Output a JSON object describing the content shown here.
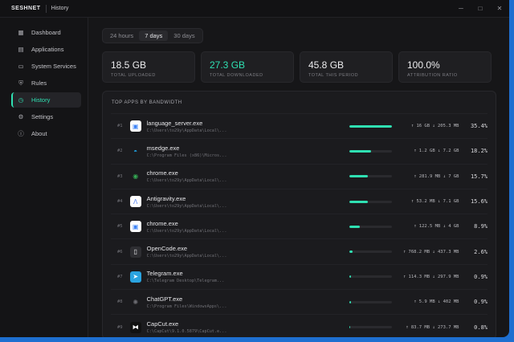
{
  "titlebar": {
    "brand": "SESHNET",
    "title": "History",
    "minimize": "─",
    "maximize": "□",
    "close": "✕"
  },
  "sidebar": {
    "items": [
      {
        "label": "Dashboard",
        "icon": "dashboard-icon",
        "glyph": "▦"
      },
      {
        "label": "Applications",
        "icon": "applications-icon",
        "glyph": "▤"
      },
      {
        "label": "System Services",
        "icon": "services-icon",
        "glyph": "▭"
      },
      {
        "label": "Rules",
        "icon": "shield-icon",
        "glyph": "⛨"
      },
      {
        "label": "History",
        "icon": "clock-icon",
        "glyph": "◷",
        "active": true
      },
      {
        "label": "Settings",
        "icon": "gear-icon",
        "glyph": "⚙"
      },
      {
        "label": "About",
        "icon": "info-icon",
        "glyph": "ⓘ"
      }
    ]
  },
  "tabs": [
    {
      "label": "24 hours"
    },
    {
      "label": "7 days",
      "active": true
    },
    {
      "label": "30 days"
    }
  ],
  "stats": [
    {
      "value": "18.5 GB",
      "label": "TOTAL UPLOADED"
    },
    {
      "value": "27.3 GB",
      "label": "TOTAL DOWNLOADED",
      "accent": true
    },
    {
      "value": "45.8 GB",
      "label": "TOTAL THIS PERIOD"
    },
    {
      "value": "100.0%",
      "label": "ATTRIBUTION RATIO"
    }
  ],
  "panel": {
    "title": "TOP APPS BY BANDWIDTH"
  },
  "colors": {
    "accent": "#2fe0b2",
    "background": "#161618",
    "card": "#1f1f22"
  },
  "apps": [
    {
      "rank": "#1",
      "name": "language_server.exe",
      "path": "C:\\Users\\to29y\\AppData\\Local\\...",
      "traffic": "↑ 16 GB  ↓ 205.3 MB",
      "pct": "35.4%",
      "share": 0.354,
      "icon": "vscode-icon",
      "glyph": "▣",
      "fg": "#3b82f6",
      "bg": "#ffffff"
    },
    {
      "rank": "#2",
      "name": "msedge.exe",
      "path": "C:\\Program Files (x86)\\Micros...",
      "traffic": "↑ 1.2 GB  ↓ 7.2 GB",
      "pct": "18.2%",
      "share": 0.182,
      "icon": "edge-icon",
      "glyph": "◓",
      "fg": "#1fa6e8",
      "bg": "transparent"
    },
    {
      "rank": "#3",
      "name": "chrome.exe",
      "path": "C:\\Users\\to29y\\AppData\\Local\\...",
      "traffic": "↑ 281.9 MB  ↓ 7 GB",
      "pct": "15.7%",
      "share": 0.157,
      "icon": "chrome-icon",
      "glyph": "◉",
      "fg": "#34a853",
      "bg": "transparent"
    },
    {
      "rank": "#4",
      "name": "Antigravity.exe",
      "path": "C:\\Users\\to29y\\AppData\\Local\\...",
      "traffic": "↑ 53.2 MB  ↓ 7.1 GB",
      "pct": "15.6%",
      "share": 0.156,
      "icon": "antigravity-icon",
      "glyph": "Λ",
      "fg": "#4f7df0",
      "bg": "#ffffff"
    },
    {
      "rank": "#5",
      "name": "chrome.exe",
      "path": "C:\\Users\\to29y\\AppData\\Local\\...",
      "traffic": "↑ 122.5 MB  ↓ 4 GB",
      "pct": "8.9%",
      "share": 0.089,
      "icon": "app-icon",
      "glyph": "▣",
      "fg": "#3b82f6",
      "bg": "#ffffff"
    },
    {
      "rank": "#6",
      "name": "OpenCode.exe",
      "path": "C:\\Users\\to29y\\AppData\\Local\\...",
      "traffic": "↑ 768.2 MB  ↓ 437.3 MB",
      "pct": "2.6%",
      "share": 0.026,
      "icon": "opencode-icon",
      "glyph": "▯",
      "fg": "#e8e8ea",
      "bg": "#2e2e32"
    },
    {
      "rank": "#7",
      "name": "Telegram.exe",
      "path": "C:\\Telegram Desktop\\Telegram...",
      "traffic": "↑ 114.3 MB  ↓ 297.9 MB",
      "pct": "0.9%",
      "share": 0.009,
      "icon": "telegram-icon",
      "glyph": "➤",
      "fg": "#ffffff",
      "bg": "#2aa3e0"
    },
    {
      "rank": "#8",
      "name": "ChatGPT.exe",
      "path": "C:\\Program Files\\WindowsApps\\...",
      "traffic": "↑ 5.9 MB  ↓ 402 MB",
      "pct": "0.9%",
      "share": 0.009,
      "icon": "chatgpt-icon",
      "glyph": "✺",
      "fg": "#6e6e74",
      "bg": "transparent"
    },
    {
      "rank": "#9",
      "name": "CapCut.exe",
      "path": "C:\\CapCut\\9.1.0.5879\\CapCut.e...",
      "traffic": "↑ 83.7 MB  ↓ 273.7 MB",
      "pct": "0.8%",
      "share": 0.008,
      "icon": "capcut-icon",
      "glyph": "⧓",
      "fg": "#ffffff",
      "bg": "#111111"
    }
  ]
}
